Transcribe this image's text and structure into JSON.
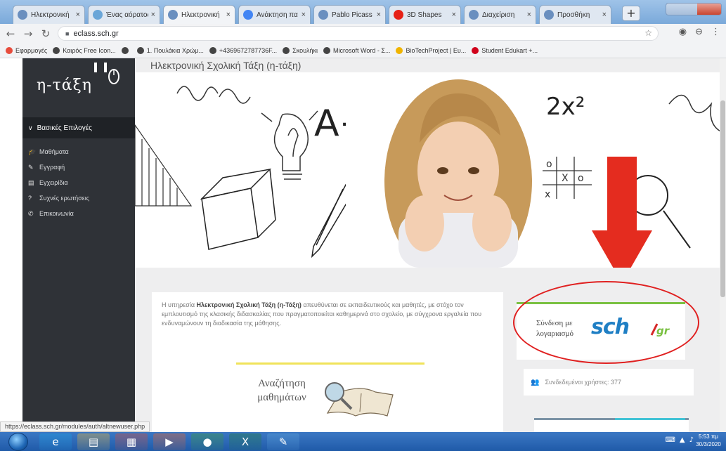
{
  "browser": {
    "tabs": [
      {
        "label": "Ηλεκτρονική",
        "icon": "globe-icon",
        "color": "#6a8fbf"
      },
      {
        "label": "Ένας αόρατος",
        "icon": "globe-icon",
        "color": "#6aa6d8"
      },
      {
        "label": "Ηλεκτρονική",
        "icon": "globe-icon",
        "color": "#6a8fbf"
      },
      {
        "label": "Ανάκτηση πα",
        "icon": "google-icon",
        "color": "#4285f4"
      },
      {
        "label": "Pablo Picass",
        "icon": "globe-icon",
        "color": "#6a8fbf"
      },
      {
        "label": "3D Shapes",
        "icon": "youtube-icon",
        "color": "#e62117"
      },
      {
        "label": "Διαχείριση",
        "icon": "globe-icon",
        "color": "#6a8fbf"
      },
      {
        "label": "Προσθήκη",
        "icon": "globe-icon",
        "color": "#6a8fbf"
      }
    ],
    "active_tab": 2,
    "url": "eclass.sch.gr",
    "bookmarks": [
      {
        "label": "Εφαρμογές",
        "color": "#e74c3c"
      },
      {
        "label": "Καιρός Free Icon...",
        "color": "#444444"
      },
      {
        "label": "",
        "color": "#444444"
      },
      {
        "label": "1. Πουλάκια Χρώμ...",
        "color": "#444444"
      },
      {
        "label": "+4369672787736F...",
        "color": "#444444"
      },
      {
        "label": "Σκουλήκι",
        "color": "#444444"
      },
      {
        "label": "Microsoft Word - Σ...",
        "color": "#444444"
      },
      {
        "label": "BioTechProject | Ευ...",
        "color": "#f0b400"
      },
      {
        "label": "Student Edukart +...",
        "color": "#d0021b"
      }
    ],
    "status_url": "https://eclass.sch.gr/modules/auth/altnewuser.php"
  },
  "sidebar": {
    "logo": "η-τάξη",
    "section_label": "Βασικές Επιλογές",
    "items": [
      {
        "label": "Μαθήματα",
        "icon": "graduation-cap-icon"
      },
      {
        "label": "Εγγραφή",
        "icon": "edit-icon"
      },
      {
        "label": "Εγχειρίδια",
        "icon": "book-icon"
      },
      {
        "label": "Συχνές ερωτήσεις",
        "icon": "question-icon"
      },
      {
        "label": "Επικοινωνία",
        "icon": "phone-icon"
      }
    ]
  },
  "main": {
    "page_title": "Ηλεκτρονική Σχολική Τάξη (η-τάξη)",
    "hero_doodles": [
      "A+",
      "2x²"
    ],
    "intro_prefix": "Η υπηρεσία ",
    "intro_bold": "Ηλεκτρονική Σχολική Τάξη (η-Τάξη)",
    "intro_rest": " απευθύνεται σε εκπαιδευτικούς και μαθητές, με στόχο τον εμπλουτισμό της κλασικής διδασκαλίας που πραγματοποιείται καθημερινά στο σχολείο, με σύγχρονα εργαλεία που ενδυναμώνουν τη διαδικασία της μάθησης.",
    "search_courses": "Αναζήτηση μαθημάτων",
    "login_label": "Σύνδεση με λογαριασμό",
    "login_brand": "sch",
    "login_brand_suffix": "gr",
    "connected_users": "Συνδεδεμένοι χρήστες: 377"
  },
  "taskbar": {
    "apps": [
      {
        "name": "internet-explorer",
        "icon": "e"
      },
      {
        "name": "file-explorer",
        "icon": "▤"
      },
      {
        "name": "calendar-app",
        "icon": "▦"
      },
      {
        "name": "media-player",
        "icon": "▶"
      },
      {
        "name": "chrome",
        "icon": "●"
      },
      {
        "name": "excel",
        "icon": "X"
      },
      {
        "name": "paint",
        "icon": "✎"
      }
    ],
    "time": "5:53 πμ",
    "date": "30/3/2020"
  },
  "colors": {
    "sidebar": "#2f3237",
    "accent_green": "#7ac142",
    "sch_blue": "#1f7fc4",
    "annotation_red": "#e02020"
  }
}
